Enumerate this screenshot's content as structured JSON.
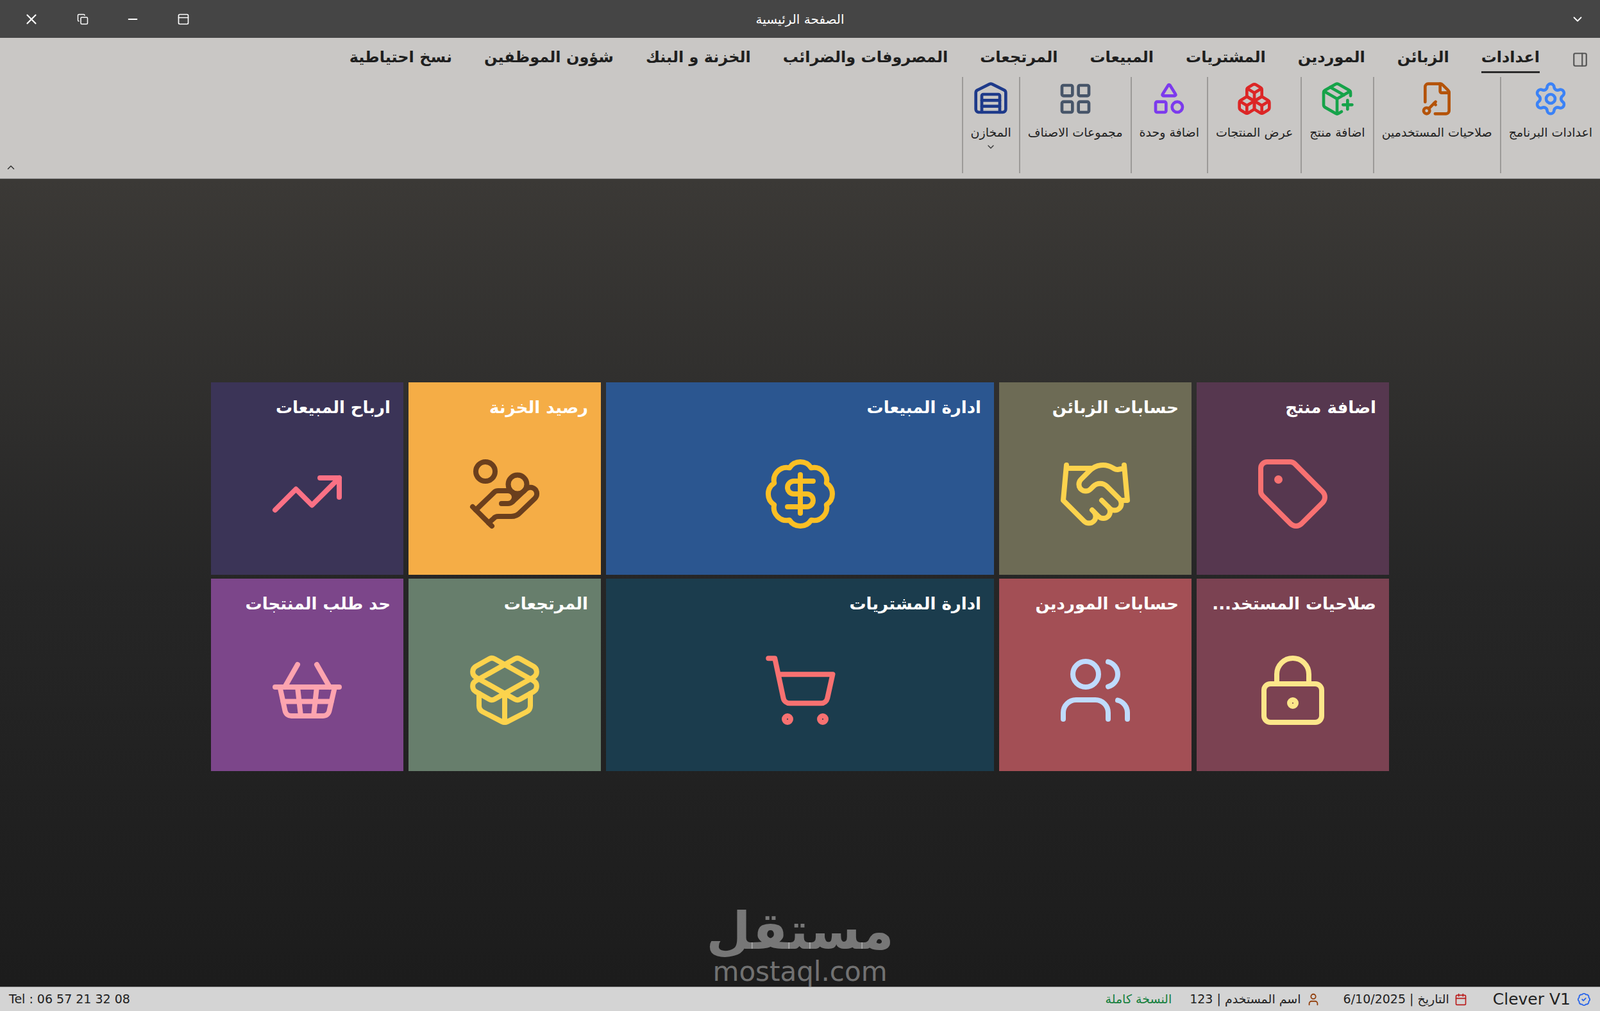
{
  "window": {
    "title": "الصفحة الرئيسية"
  },
  "ribbon": {
    "tabs": [
      {
        "label": "اعدادات",
        "selected": true
      },
      {
        "label": "الزبائن",
        "selected": false
      },
      {
        "label": "الموردين",
        "selected": false
      },
      {
        "label": "المشتريات",
        "selected": false
      },
      {
        "label": "المبيعات",
        "selected": false
      },
      {
        "label": "المرتجعات",
        "selected": false
      },
      {
        "label": "المصروفات والضرائب",
        "selected": false
      },
      {
        "label": "الخزنة و البنك",
        "selected": false
      },
      {
        "label": "شؤون الموظفين",
        "selected": false
      },
      {
        "label": "نسخ احتياطية",
        "selected": false
      }
    ],
    "buttons": [
      {
        "label": "اعدادات البرنامج",
        "has_menu": false
      },
      {
        "label": "صلاحيات المستخدمين",
        "has_menu": false
      },
      {
        "label": "اضافة منتج",
        "has_menu": false
      },
      {
        "label": "عرض المنتجات",
        "has_menu": false
      },
      {
        "label": "اضافة وحدة",
        "has_menu": false
      },
      {
        "label": "مجموعات الاصناف",
        "has_menu": false
      },
      {
        "label": "المخازن",
        "has_menu": true
      }
    ]
  },
  "tiles": [
    {
      "title": "اضافة منتج",
      "color": "#56374f"
    },
    {
      "title": "حسابات الزبائن",
      "color": "#6d6b55"
    },
    {
      "title": "ادارة المبيعات",
      "color": "#2b5690"
    },
    {
      "title": "رصيد الخزنة",
      "color": "#f5ad46"
    },
    {
      "title": "ارباح المبيعات",
      "color": "#3b3457"
    },
    {
      "title": "صلاحيات المستخد...",
      "color": "#7b4252"
    },
    {
      "title": "حسابات الموردين",
      "color": "#a34f55"
    },
    {
      "title": "ادارة المشتريات",
      "color": "#1b3c4d"
    },
    {
      "title": "المرتجعات",
      "color": "#677e6c"
    },
    {
      "title": "حد طلب المنتجات",
      "color": "#7c468a"
    }
  ],
  "watermark": {
    "arabic": "مستقل",
    "latin": "mostaql.com"
  },
  "status_bar": {
    "app": "Clever V1",
    "date": "التاريخ | 6/10/2025",
    "user": "اسم المستخدم | 123",
    "license": "النسخة كاملة",
    "phone": "Tel : 06 57 21 32 08"
  }
}
